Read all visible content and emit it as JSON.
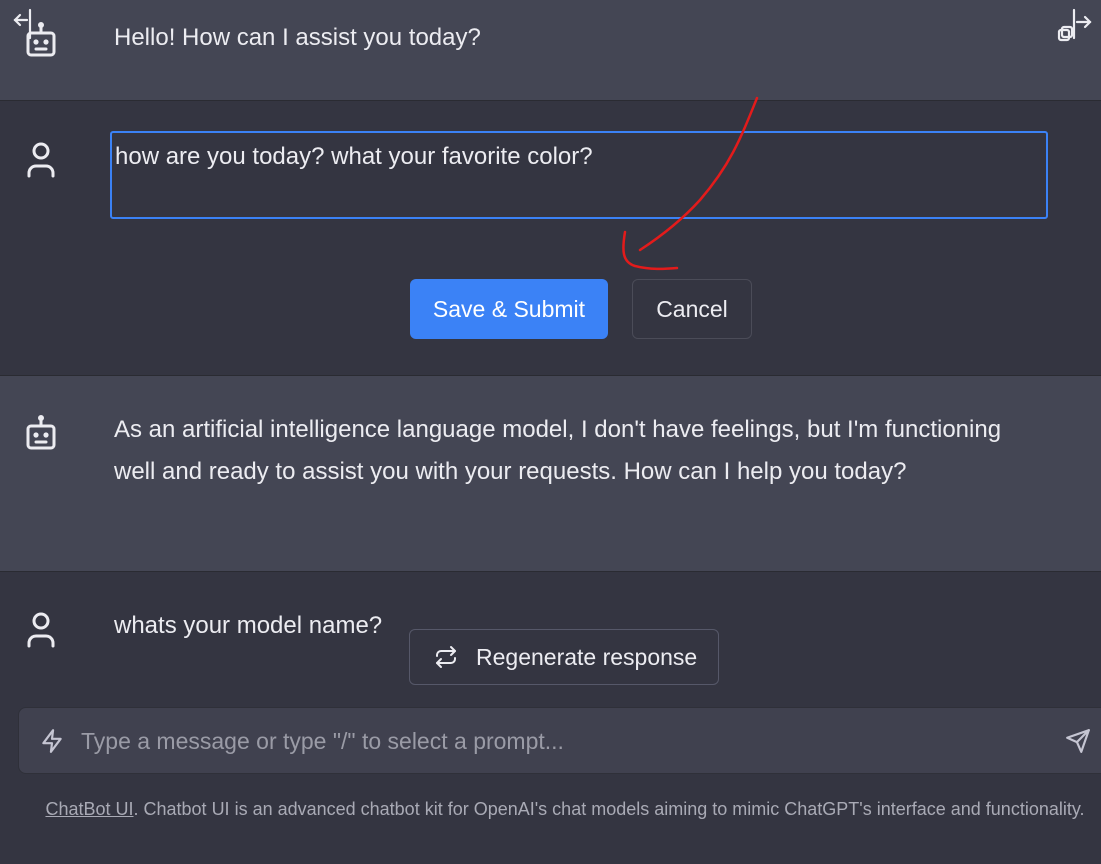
{
  "messages": [
    {
      "role": "assistant",
      "text": "Hello! How can I assist you today?"
    },
    {
      "role": "user",
      "text": "how are you today? what your favorite color?",
      "editing": true
    },
    {
      "role": "assistant",
      "text": "As an artificial intelligence language model, I don't have feelings, but I'm functioning well and ready to assist you with your requests. How can I help you today?"
    },
    {
      "role": "user",
      "text": "whats your model name?"
    }
  ],
  "edit": {
    "save_label": "Save & Submit",
    "cancel_label": "Cancel"
  },
  "regenerate_label": "Regenerate response",
  "composer": {
    "placeholder": "Type a message or type \"/\" to select a prompt..."
  },
  "footer": {
    "link_text": "ChatBot UI",
    "text": ". Chatbot UI is an advanced chatbot kit for OpenAI's chat models aiming to mimic ChatGPT's interface and functionality."
  },
  "icons": {
    "bot": "robot-icon",
    "user": "user-icon",
    "regenerate": "refresh-icon",
    "composer_left": "lightning-bolt-icon",
    "send": "send-icon",
    "sidebar_left": "sidebar-toggle-left-icon",
    "sidebar_right": "sidebar-toggle-right-icon"
  },
  "colors": {
    "accent": "#3b82f6",
    "bot_row_bg": "#444654",
    "user_row_bg": "#343541",
    "annotation": "#e31b1b"
  }
}
